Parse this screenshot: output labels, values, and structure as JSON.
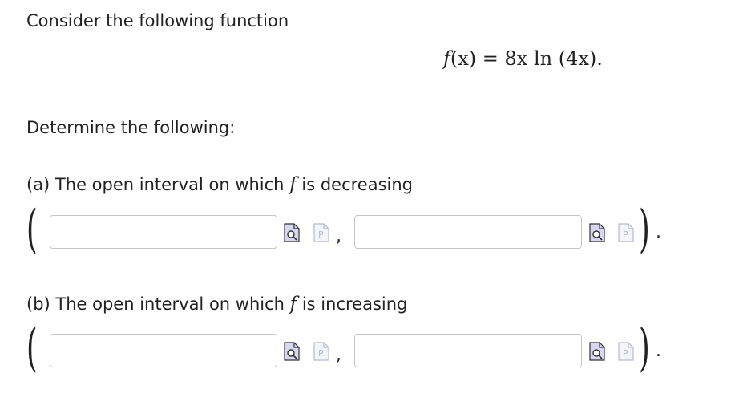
{
  "intro": "Consider the following function",
  "formula": {
    "lhs_fn": "f",
    "lhs_rest": "(x) = 8x ln (4x)."
  },
  "instruction": "Determine the following:",
  "parts": [
    {
      "label_before": "(a) The open interval on which",
      "fn": "f",
      "label_after": "is decreasing",
      "open_paren": "(",
      "close_paren": ")",
      "separator": ",",
      "terminator": ".",
      "left_value": "",
      "right_value": ""
    },
    {
      "label_before": "(b) The open interval on which",
      "fn": "f",
      "label_after": "is increasing",
      "open_paren": "(",
      "close_paren": ")",
      "separator": ",",
      "terminator": ".",
      "left_value": "",
      "right_value": ""
    }
  ],
  "icons": {
    "preview": "preview-icon",
    "palette": "math-palette-icon"
  }
}
